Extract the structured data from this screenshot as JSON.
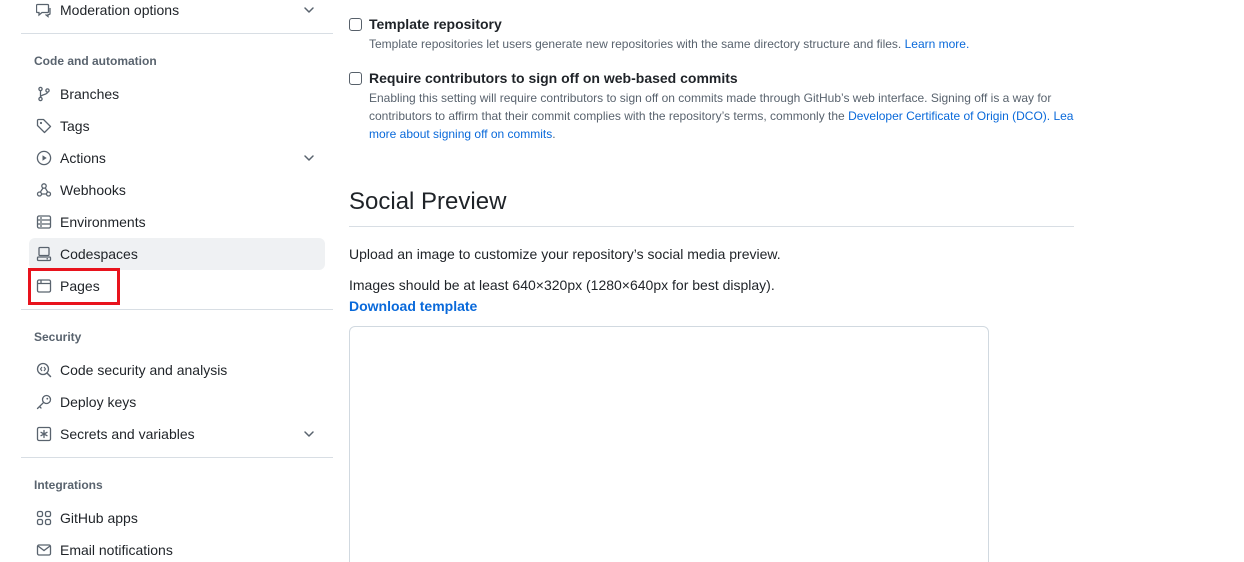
{
  "sidebar": {
    "moderation": {
      "label": "Moderation options",
      "icon": "report-icon"
    },
    "groups": {
      "code_automation": "Code and automation",
      "security": "Security",
      "integrations": "Integrations"
    },
    "items": {
      "branches": "Branches",
      "tags": "Tags",
      "actions": "Actions",
      "webhooks": "Webhooks",
      "environments": "Environments",
      "codespaces": "Codespaces",
      "pages": "Pages",
      "code_security": "Code security and analysis",
      "deploy_keys": "Deploy keys",
      "secrets": "Secrets and variables",
      "github_apps": "GitHub apps",
      "email_notifications": "Email notifications"
    },
    "active_item": "Codespaces",
    "highlight_color": "#e8131d"
  },
  "main": {
    "template_repo": {
      "title": "Template repository",
      "desc": "Template repositories let users generate new repositories with the same directory structure and files.",
      "link": "Learn more."
    },
    "signoff": {
      "title": "Require contributors to sign off on web-based commits",
      "desc_line1": "Enabling this setting will require contributors to sign off on commits made through GitHub’s web interface. Signing off is a way for",
      "desc_line2_text": "contributors to affirm that their commit complies with the repository’s terms, commonly the ",
      "desc_line2_link": "Developer Certificate of Origin (DCO). Lea",
      "desc_line3_link": "more about signing off on commits",
      "desc_line3_end": "."
    },
    "social_preview": {
      "heading": "Social Preview",
      "upload_text": "Upload an image to customize your repository’s social media preview.",
      "size_text": "Images should be at least 640×320px (1280×640px for best display).",
      "download_link": "Download template"
    },
    "link_color": "#0969da"
  }
}
